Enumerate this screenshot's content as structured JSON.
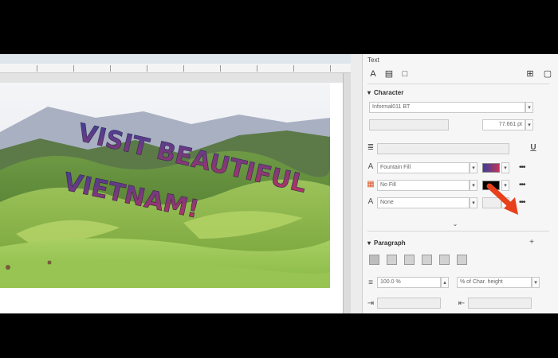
{
  "banner": {
    "line1": "VISIT BEAUTIFUL",
    "line2": "VIETNAM!"
  },
  "panel": {
    "title": "Text",
    "character": {
      "heading": "Character",
      "font_name": "Informal011 BT",
      "font_size": "77.661 pt",
      "fill_type": "Fountain Fill",
      "background_fill": "No Fill",
      "outline": "None",
      "more_label": "•••"
    },
    "paragraph": {
      "heading": "Paragraph",
      "spacing_value": "100.0 %",
      "spacing_unit": "% of Char. height"
    }
  },
  "colors": {
    "banner_top": "#3a3f9a",
    "banner_bottom": "#c0345a",
    "accent_arrow": "#e8401c",
    "panel_bg": "#f6f6f6"
  }
}
